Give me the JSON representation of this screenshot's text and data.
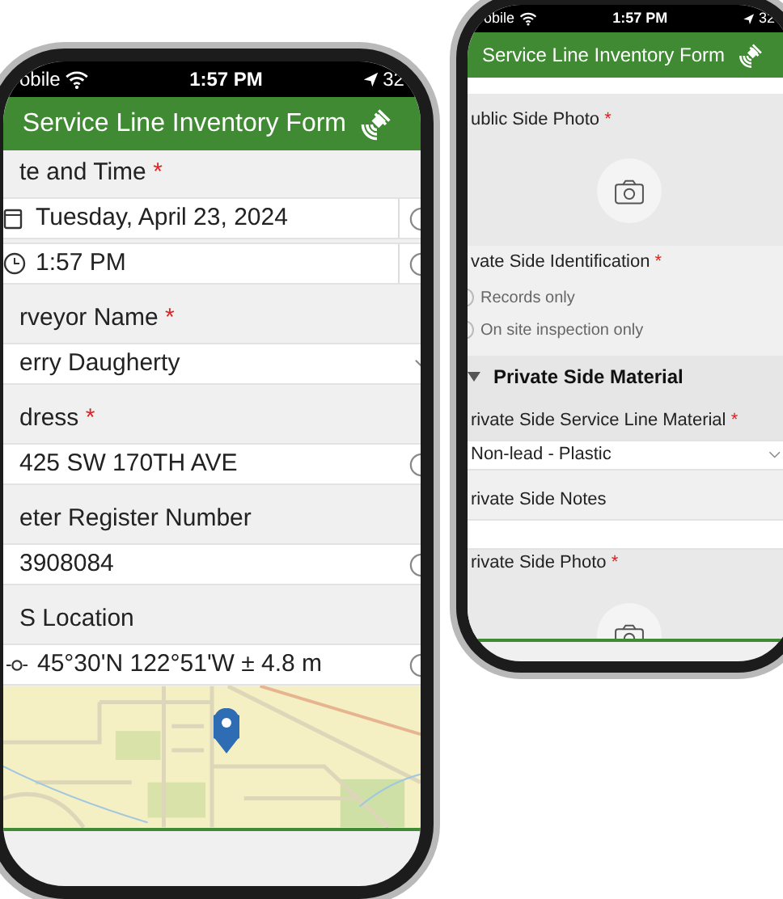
{
  "phones": [
    {
      "status_bar": {
        "carrier": "obile",
        "time": "1:57 PM",
        "battery": "32"
      },
      "header": {
        "title": "Service Line Inventory Form"
      },
      "fields": [
        {
          "kind": "datetime",
          "label": "te and Time",
          "asterisk": "*",
          "date": "Tuesday, April 23, 2024",
          "time": "1:57 PM"
        },
        {
          "kind": "select",
          "label": "rveyor Name",
          "asterisk": "*",
          "value": "erry Daugherty"
        },
        {
          "kind": "text",
          "label": "dress",
          "asterisk": "*",
          "value": "425 SW 170TH AVE"
        },
        {
          "kind": "text",
          "label": "eter Register Number",
          "value": "3908084"
        },
        {
          "kind": "location",
          "label": "S Location",
          "value": "45°30'N 122°51'W ± 4.8 m"
        }
      ]
    },
    {
      "status_bar": {
        "carrier": "obile",
        "time": "1:57 PM",
        "battery": "32"
      },
      "header": {
        "title": "Service Line Inventory Form"
      },
      "fields": [
        {
          "kind": "photo",
          "label": "ublic Side Photo",
          "asterisk": "*"
        },
        {
          "kind": "radio",
          "label": "vate Side Identification",
          "asterisk": "*",
          "options": [
            "Records only",
            "On site inspection only"
          ]
        },
        {
          "kind": "group",
          "title": "Private Side Material",
          "expanded": true
        },
        {
          "kind": "select",
          "label": "rivate Side Service Line Material",
          "asterisk": "*",
          "value": "Non-lead - Plastic"
        },
        {
          "kind": "text",
          "label": "rivate Side Notes"
        },
        {
          "kind": "photo_partial",
          "label": "rivate Side Photo",
          "asterisk": "*"
        }
      ]
    }
  ]
}
